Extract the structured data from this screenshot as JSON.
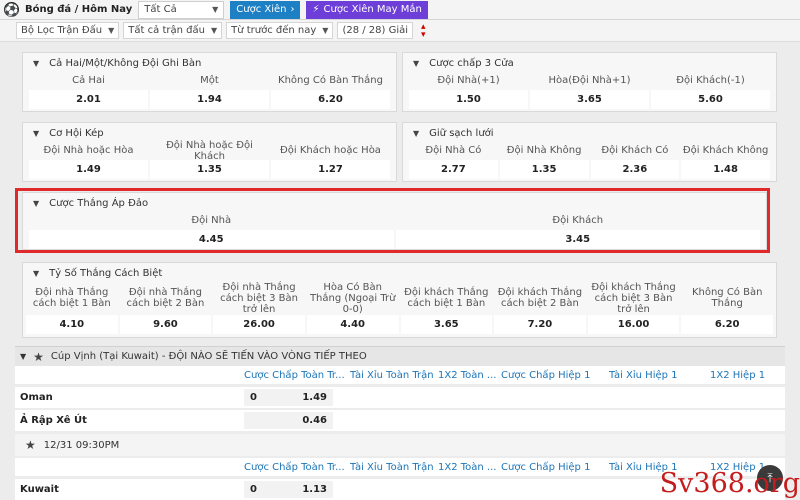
{
  "topbar": {
    "brand": "Bóng đá / Hôm Nay",
    "type_select": "Tất Cả",
    "btn_parlay": "Cược Xiên",
    "btn_lucky": "Cược Xiên May Mắn"
  },
  "filters": {
    "match_filter": "Bộ Lọc Trận Đấu",
    "all_matches": "Tất cả trận đấu",
    "sort": "Từ trước đến nay",
    "league_count": "(28 / 28) Giải"
  },
  "markets": {
    "m1": {
      "title": "Cả Hai/Một/Không Đội Ghi Bàn",
      "items": [
        {
          "label": "Cả Hai",
          "odd": "2.01"
        },
        {
          "label": "Một",
          "odd": "1.94"
        },
        {
          "label": "Không Có Bàn Thắng",
          "odd": "6.20"
        }
      ]
    },
    "m2": {
      "title": "Cược chấp 3 Cửa",
      "items": [
        {
          "label": "Đội Nhà(+1)",
          "odd": "1.50"
        },
        {
          "label": "Hòa(Đội Nhà+1)",
          "odd": "3.65"
        },
        {
          "label": "Đội Khách(-1)",
          "odd": "5.60"
        }
      ]
    },
    "m3": {
      "title": "Cơ Hội Kép",
      "items": [
        {
          "label": "Đội Nhà hoặc Hòa",
          "odd": "1.49"
        },
        {
          "label": "Đội Nhà hoặc Đội Khách",
          "odd": "1.35"
        },
        {
          "label": "Đội Khách hoặc Hòa",
          "odd": "1.27"
        }
      ]
    },
    "m4": {
      "title": "Giữ sạch lưới",
      "items": [
        {
          "label": "Đội Nhà Có",
          "odd": "2.77"
        },
        {
          "label": "Đội Nhà Không",
          "odd": "1.35"
        },
        {
          "label": "Đội Khách Có",
          "odd": "2.36"
        },
        {
          "label": "Đội Khách Không",
          "odd": "1.48"
        }
      ]
    },
    "m5": {
      "title": "Cược Thắng Áp Đảo",
      "items": [
        {
          "label": "Đội Nhà",
          "odd": "4.45"
        },
        {
          "label": "Đội Khách",
          "odd": "3.45"
        }
      ]
    },
    "m6": {
      "title": "Tỷ Số Thắng Cách Biệt",
      "items": [
        {
          "label": "Đội nhà Thắng cách biệt 1 Bàn",
          "odd": "4.10"
        },
        {
          "label": "Đội nhà Thắng cách biệt 2 Bàn",
          "odd": "9.60"
        },
        {
          "label": "Đội nhà Thắng cách biệt 3 Bàn trở lên",
          "odd": "26.00"
        },
        {
          "label": "Hòa Có Bàn Thắng (Ngoại Trừ 0-0)",
          "odd": "4.40"
        },
        {
          "label": "Đội khách Thắng cách biệt 1 Bàn",
          "odd": "3.65"
        },
        {
          "label": "Đội khách Thắng cách biệt 2 Bàn",
          "odd": "7.20"
        },
        {
          "label": "Đội khách Thắng cách biệt 3 Bàn trở lên",
          "odd": "16.00"
        },
        {
          "label": "Không Có Bàn Thắng",
          "odd": "6.20"
        }
      ]
    }
  },
  "league": {
    "name": "Cúp Vịnh (Tại Kuwait) - ĐỘI NÀO SẼ TIẾN VÀO VÒNG TIẾP THEO"
  },
  "col_headers": [
    "Cược Chấp Toàn Tr...",
    "Tài Xỉu Toàn Trận",
    "1X2 Toàn ...",
    "Cược Chấp Hiệp 1",
    "Tài Xỉu Hiệp 1",
    "1X2 Hiệp 1"
  ],
  "match1": {
    "home": "Oman",
    "home_hdp": "0",
    "home_odd": "1.49",
    "away": "Ả Rập Xê Út",
    "away_odd": "0.46"
  },
  "match2": {
    "time": "12/31 09:30PM",
    "home": "Kuwait",
    "home_hdp": "0",
    "home_odd": "1.13"
  },
  "watermark": "Sv368.org"
}
